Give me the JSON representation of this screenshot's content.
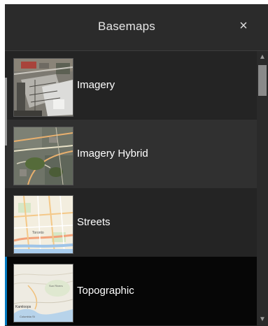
{
  "panel": {
    "title": "Basemaps",
    "close_icon": "close-icon",
    "close_glyph": "×"
  },
  "basemaps": [
    {
      "label": "Imagery",
      "thumbnail": "imagery-thumbnail",
      "state": "default"
    },
    {
      "label": "Imagery Hybrid",
      "thumbnail": "imagery-hybrid-thumbnail",
      "state": "hover"
    },
    {
      "label": "Streets",
      "thumbnail": "streets-thumbnail",
      "state": "default"
    },
    {
      "label": "Topographic",
      "thumbnail": "topographic-thumbnail",
      "state": "selected"
    }
  ],
  "colors": {
    "panel_bg": "#242424",
    "selected_bg": "#060606",
    "accent": "#0079c1"
  },
  "scrollbar": {
    "up_glyph": "▲",
    "down_glyph": "▼"
  }
}
